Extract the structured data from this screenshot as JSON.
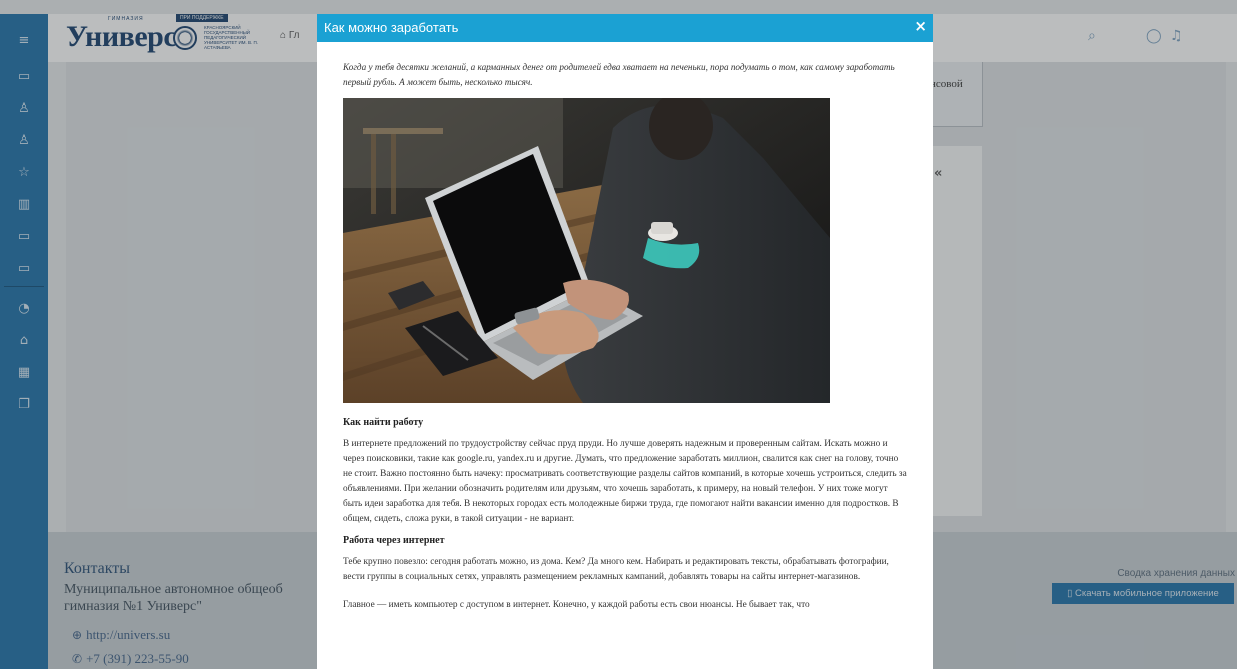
{
  "topbar": {
    "logo_text": "Универс",
    "logo_tag": "ГИМНАЗИЯ",
    "support_label": "ПРИ ПОДДЕРЖКЕ",
    "partner_text": "КРАСНОЯРСКИЙ ГОСУДАРСТВЕННЫЙ ПЕДАГОГИЧЕСКИЙ УНИВЕРСИТЕТ ИМ. В. П. АСТАФЬЕВА",
    "breadcrumb": "Гл"
  },
  "background": {
    "card_text": "нсовой",
    "card_mark": "«"
  },
  "footer": {
    "contacts_title": "Контакты",
    "organization": "Муниципальное автономное общеоб гимназия №1 Универс\"",
    "website": "http://univers.su",
    "phone": "+7 (391) 223-55-90",
    "storage_link": "Сводка хранения данных",
    "app_button": "Скачать мобильное приложение"
  },
  "modal": {
    "title": "Как можно заработать",
    "close_glyph": "×",
    "intro": "Когда у тебя десятки желаний, а карманных денег от родителей едва хватает на печеньки, пора подумать о том, как самому заработать первый рубль. А может быть, несколько тысяч.",
    "section1_heading": "Как найти работу",
    "section1_text": "В интернете предложений по трудоустройству сейчас пруд пруди. Но лучше доверять надежным и проверенным сайтам. Искать можно и через поисковики, такие как google.ru, yandex.ru и другие. Думать, что предложение заработать миллион, свалится как снег на голову, точно не стоит. Важно постоянно быть начеку: просматривать соответствующие разделы сайтов компаний, в которые хочешь устроиться, следить за объявлениями. При желании обозначить родителям или друзьям, что хочешь заработать, к примеру, на новый телефон. У них тоже могут быть идеи заработка для тебя. В некоторых городах есть молодежные биржи труда, где помогают найти вакансии именно для подростков. В общем, сидеть, сложа руки, в такой ситуации - не вариант.",
    "section2_heading": "Работа через интернет",
    "section2_text": "Тебе крупно повезло: сегодня работать можно, из дома. Кем? Да много кем. Набирать и редактировать тексты, обрабатывать фотографии, вести группы в социальных сетях, управлять размещением рекламных кампаний, добавлять товары на сайты интернет-магазинов.",
    "section3_text": "Главное — иметь компьютер с доступом в интернет. Конечно, у каждой работы есть свои нюансы. Не бывает так, что"
  }
}
